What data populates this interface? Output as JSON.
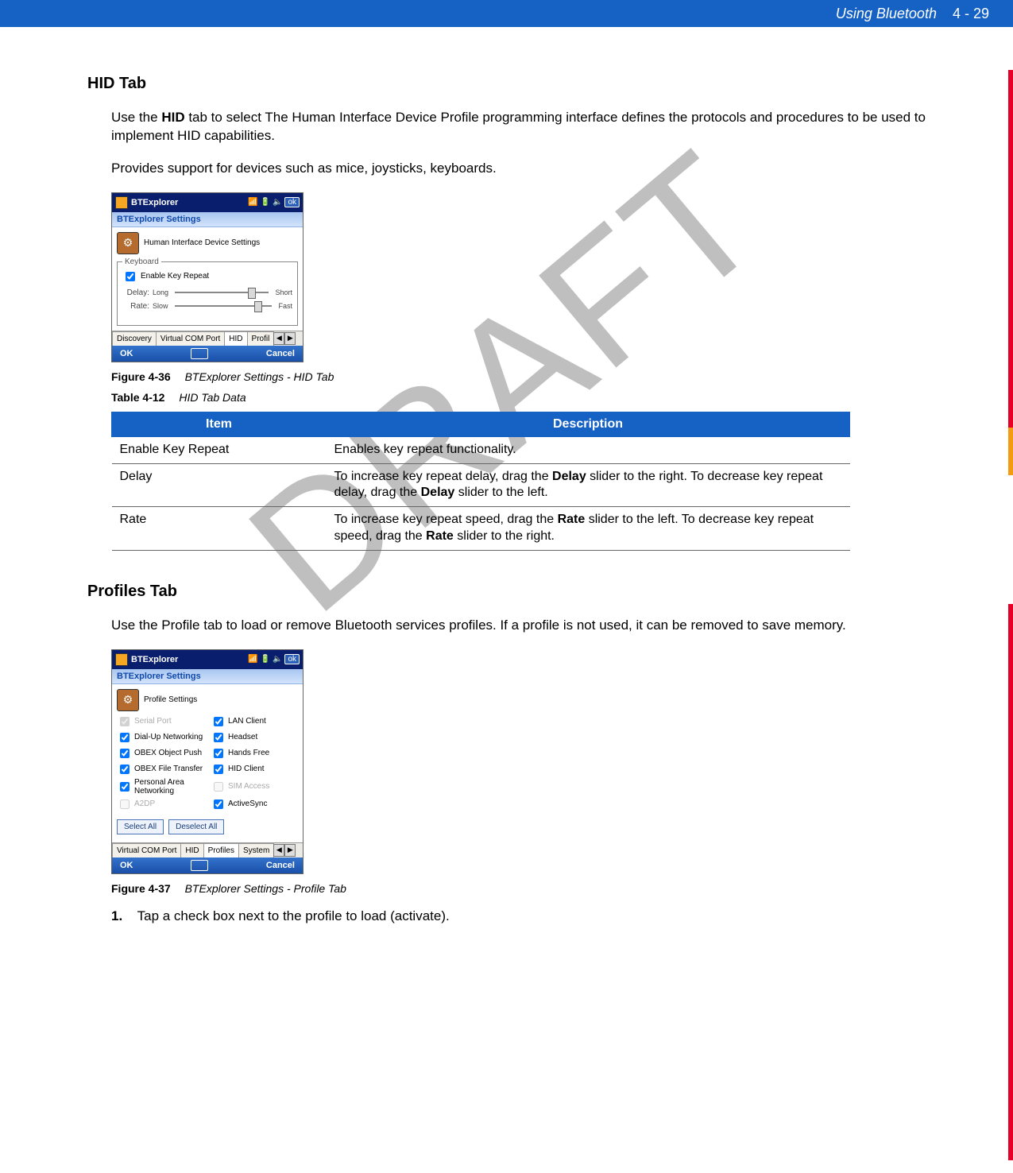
{
  "header": {
    "chapter": "Using Bluetooth",
    "page": "4 - 29"
  },
  "watermark": "DRAFT",
  "hid": {
    "heading": "HID Tab",
    "para1a": "Use the ",
    "para1b": "HID",
    "para1c": " tab to select The Human Interface Device Profile programming interface defines the protocols and procedures to be used to implement HID capabilities.",
    "para2": "Provides support for devices such as mice, joysticks, keyboards.",
    "figure_num": "Figure 4-36",
    "figure_title": "BTExplorer Settings - HID Tab",
    "table_num": "Table 4-12",
    "table_title": "HID Tab Data",
    "table_headers": {
      "item": "Item",
      "desc": "Description"
    },
    "rows": [
      {
        "item": "Enable Key Repeat",
        "desc": "Enables key repeat functionality."
      },
      {
        "item": "Delay",
        "desc_a": "To increase key repeat delay, drag the ",
        "desc_b": "Delay",
        "desc_c": " slider to the right. To decrease key repeat delay, drag the ",
        "desc_d": "Delay",
        "desc_e": " slider to the left."
      },
      {
        "item": "Rate",
        "desc_a": "To increase key repeat speed, drag the ",
        "desc_b": "Rate",
        "desc_c": " slider to the left. To decrease key repeat speed, drag the ",
        "desc_d": "Rate",
        "desc_e": " slider to the right."
      }
    ]
  },
  "profiles": {
    "heading": "Profiles Tab",
    "para1": "Use the Profile tab to load or remove Bluetooth services profiles. If a profile is not used, it can be removed to save memory.",
    "figure_num": "Figure 4-37",
    "figure_title": "BTExplorer Settings - Profile Tab",
    "step1_num": "1.",
    "step1_text": "Tap a check box next to the profile to load (activate)."
  },
  "mock_common": {
    "app_title": "BTExplorer",
    "subtitle": "BTExplorer Settings",
    "ok": "ok",
    "bottom_ok": "OK",
    "bottom_cancel": "Cancel"
  },
  "mock_hid": {
    "panel_title": "Human Interface Device Settings",
    "fieldset": "Keyboard",
    "enable_label": "Enable Key Repeat",
    "delay_label": "Delay:",
    "delay_left": "Long",
    "delay_right": "Short",
    "rate_label": "Rate:",
    "rate_left": "Slow",
    "rate_right": "Fast",
    "tabs": [
      "Discovery",
      "Virtual COM Port",
      "HID",
      "Profil"
    ]
  },
  "mock_profiles": {
    "panel_title": "Profile Settings",
    "items_left": [
      {
        "label": "Serial Port",
        "checked": true,
        "disabled": true
      },
      {
        "label": "Dial-Up Networking",
        "checked": true
      },
      {
        "label": "OBEX Object Push",
        "checked": true
      },
      {
        "label": "OBEX File Transfer",
        "checked": true
      },
      {
        "label": "Personal Area Networking",
        "checked": true
      },
      {
        "label": "A2DP",
        "checked": false,
        "disabled": true
      }
    ],
    "items_right": [
      {
        "label": "LAN Client",
        "checked": true
      },
      {
        "label": "Headset",
        "checked": true
      },
      {
        "label": "Hands Free",
        "checked": true
      },
      {
        "label": "HID Client",
        "checked": true
      },
      {
        "label": "SIM Access",
        "checked": false,
        "disabled": true
      },
      {
        "label": "ActiveSync",
        "checked": true
      }
    ],
    "select_all": "Select All",
    "deselect_all": "Deselect All",
    "tabs": [
      "Virtual COM Port",
      "HID",
      "Profiles",
      "System"
    ]
  }
}
